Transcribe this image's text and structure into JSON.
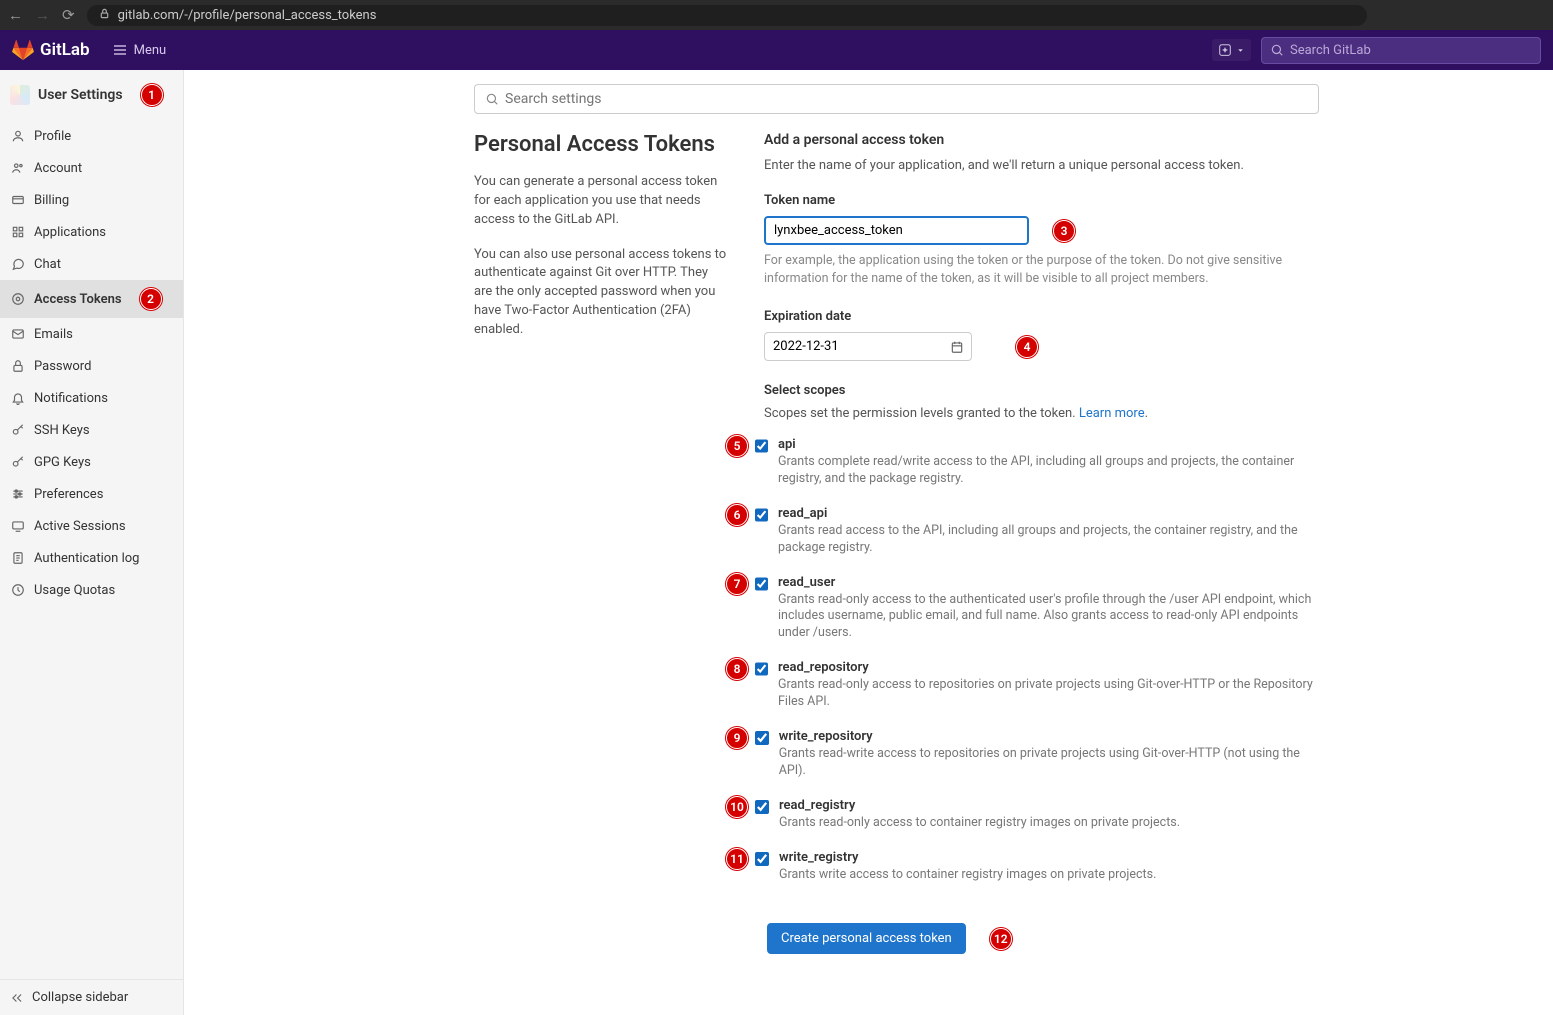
{
  "browser": {
    "url": "gitlab.com/-/profile/personal_access_tokens"
  },
  "header": {
    "brand": "GitLab",
    "menu_label": "Menu",
    "search_placeholder": "Search GitLab"
  },
  "sidebar": {
    "title": "User Settings",
    "items": [
      {
        "label": "Profile",
        "icon": "profile"
      },
      {
        "label": "Account",
        "icon": "account"
      },
      {
        "label": "Billing",
        "icon": "billing"
      },
      {
        "label": "Applications",
        "icon": "apps"
      },
      {
        "label": "Chat",
        "icon": "chat"
      },
      {
        "label": "Access Tokens",
        "icon": "token"
      },
      {
        "label": "Emails",
        "icon": "email"
      },
      {
        "label": "Password",
        "icon": "lock"
      },
      {
        "label": "Notifications",
        "icon": "bell"
      },
      {
        "label": "SSH Keys",
        "icon": "key"
      },
      {
        "label": "GPG Keys",
        "icon": "key"
      },
      {
        "label": "Preferences",
        "icon": "prefs"
      },
      {
        "label": "Active Sessions",
        "icon": "sessions"
      },
      {
        "label": "Authentication log",
        "icon": "log"
      },
      {
        "label": "Usage Quotas",
        "icon": "quota"
      }
    ],
    "collapse_label": "Collapse sidebar"
  },
  "content": {
    "settings_search_placeholder": "Search settings",
    "title": "Personal Access Tokens",
    "help1": "You can generate a personal access token for each application you use that needs access to the GitLab API.",
    "help2": "You can also use personal access tokens to authenticate against Git over HTTP. They are the only accepted password when you have Two-Factor Authentication (2FA) enabled.",
    "form": {
      "heading": "Add a personal access token",
      "subheading": "Enter the name of your application, and we'll return a unique personal access token.",
      "name_label": "Token name",
      "name_value": "lynxbee_access_token",
      "name_help": "For example, the application using the token or the purpose of the token. Do not give sensitive information for the name of the token, as it will be visible to all project members.",
      "date_label": "Expiration date",
      "date_value": "2022-12-31",
      "scopes_label": "Select scopes",
      "scopes_help": "Scopes set the permission levels granted to the token. ",
      "learn_more": "Learn more",
      "scopes": [
        {
          "name": "api",
          "desc": "Grants complete read/write access to the API, including all groups and projects, the container registry, and the package registry.",
          "checked": true
        },
        {
          "name": "read_api",
          "desc": "Grants read access to the API, including all groups and projects, the container registry, and the package registry.",
          "checked": true
        },
        {
          "name": "read_user",
          "desc": "Grants read-only access to the authenticated user's profile through the /user API endpoint, which includes username, public email, and full name. Also grants access to read-only API endpoints under /users.",
          "checked": true
        },
        {
          "name": "read_repository",
          "desc": "Grants read-only access to repositories on private projects using Git-over-HTTP or the Repository Files API.",
          "checked": true
        },
        {
          "name": "write_repository",
          "desc": "Grants read-write access to repositories on private projects using Git-over-HTTP (not using the API).",
          "checked": true
        },
        {
          "name": "read_registry",
          "desc": "Grants read-only access to container registry images on private projects.",
          "checked": true
        },
        {
          "name": "write_registry",
          "desc": "Grants write access to container registry images on private projects.",
          "checked": true
        }
      ],
      "submit_label": "Create personal access token"
    }
  },
  "annotations": [
    "1",
    "2",
    "3",
    "4",
    "5",
    "6",
    "7",
    "8",
    "9",
    "10",
    "11",
    "12"
  ]
}
